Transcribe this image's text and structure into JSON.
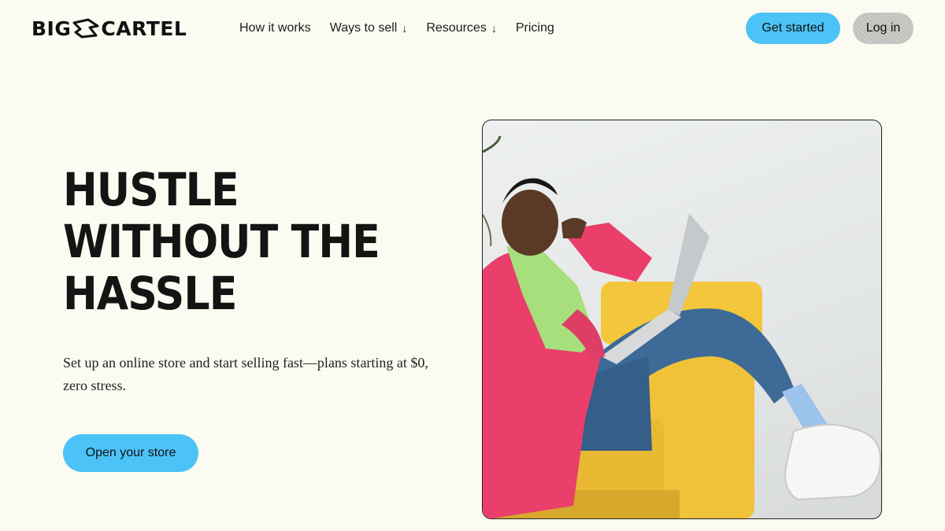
{
  "header": {
    "logo": {
      "left_text": "BIG",
      "right_text": "CARTEL",
      "icon": "cartel-bird-icon"
    },
    "nav": [
      {
        "label": "How it works",
        "has_dropdown": false
      },
      {
        "label": "Ways to sell",
        "has_dropdown": true
      },
      {
        "label": "Resources",
        "has_dropdown": true
      },
      {
        "label": "Pricing",
        "has_dropdown": false
      }
    ],
    "dropdown_arrow": "↓",
    "get_started_label": "Get started",
    "login_label": "Log in"
  },
  "hero": {
    "headline_lines": [
      "HUSTLE",
      "WITHOUT THE",
      "HASSLE"
    ],
    "subtext": "Set up an online store and start selling fast—plans starting at $0, zero stress.",
    "cta_label": "Open your store"
  },
  "colors": {
    "background": "#fcfbf1",
    "accent": "#4cc3f7",
    "login_bg": "#c9c9c6",
    "text": "#161616"
  }
}
